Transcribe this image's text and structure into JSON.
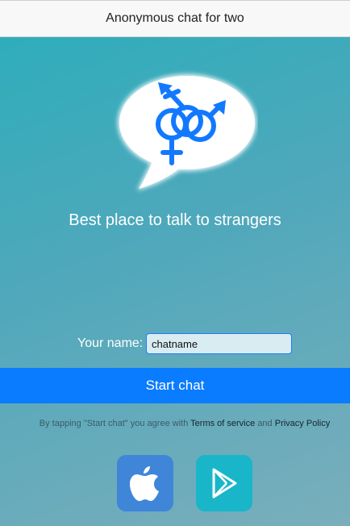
{
  "header": {
    "title": "Anonymous chat for two"
  },
  "hero": {
    "logo_icon": "gender-symbols-speech-bubble-icon",
    "tagline": "Best place to talk to strangers"
  },
  "form": {
    "name_label": "Your name:",
    "name_value": "chatname",
    "start_button": "Start chat"
  },
  "terms": {
    "prefix": "By tapping \"Start chat\" you agree with",
    "terms_link": "Terms of service",
    "connector": "and",
    "privacy_link": "Privacy Policy"
  },
  "stores": [
    {
      "icon": "apple-icon",
      "color": "#3f86d9"
    },
    {
      "icon": "google-play-icon",
      "color": "#19b6c9"
    }
  ],
  "colors": {
    "accent": "#0a7cff",
    "background_start": "#2aaebb",
    "background_end": "#7aaebb"
  }
}
